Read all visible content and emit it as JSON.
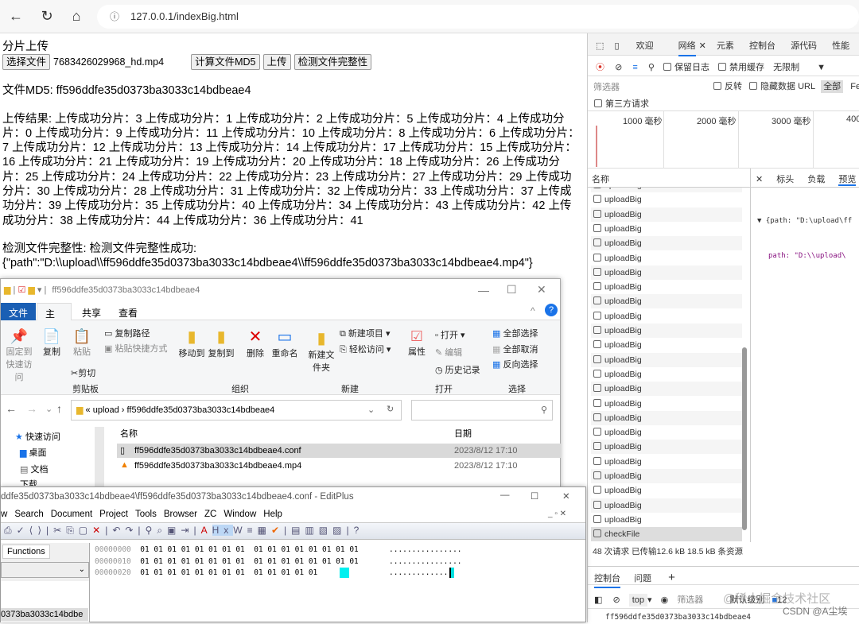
{
  "browser": {
    "url": "127.0.0.1/indexBig.html"
  },
  "page": {
    "title": "分片上传",
    "choose_file": "选择文件",
    "file_name": "7683426029968_hd.mp4",
    "calc_md5": "计算文件MD5",
    "upload": "上传",
    "check": "检测文件完整性",
    "md5_line": "文件MD5: ff596ddfe35d0373ba3033c14bdbeae4",
    "upload_result": "上传结果: 上传成功分片：3 上传成功分片：1 上传成功分片：2 上传成功分片：5 上传成功分片：4 上传成功分片：0 上传成功分片：9 上传成功分片：11 上传成功分片：10 上传成功分片：8 上传成功分片：6 上传成功分片：7 上传成功分片：12 上传成功分片：13 上传成功分片：14 上传成功分片：17 上传成功分片：15 上传成功分片：16 上传成功分片：21 上传成功分片：19 上传成功分片：20 上传成功分片：18 上传成功分片：26 上传成功分片：25 上传成功分片：24 上传成功分片：22 上传成功分片：23 上传成功分片：27 上传成功分片：29 上传成功分片：30 上传成功分片：28 上传成功分片：31 上传成功分片：32 上传成功分片：33 上传成功分片：37 上传成功分片：39 上传成功分片：35 上传成功分片：40 上传成功分片：34 上传成功分片：43 上传成功分片：42 上传成功分片：38 上传成功分片：44 上传成功分片：36 上传成功分片：41",
    "check_result": "检测文件完整性: 检测文件完整性成功:",
    "check_json": "{\"path\":\"D:\\\\upload\\\\ff596ddfe35d0373ba3033c14bdbeae4\\\\ff596ddfe35d0373ba3033c14bdbeae4.mp4\"}"
  },
  "devtools": {
    "tabs": [
      "欢迎",
      "网络",
      "元素",
      "控制台",
      "源代码",
      "性能"
    ],
    "preserve_log": "保留日志",
    "disable_cache": "禁用缓存",
    "throttle": "无限制",
    "filter_placeholder": "筛选器",
    "invert": "反转",
    "hide_data_url": "隐藏数据 URL",
    "all": "全部",
    "fetch": "Fetc",
    "third_party": "第三方请求",
    "timeline": [
      "1000 毫秒",
      "2000 毫秒",
      "3000 毫秒",
      "400"
    ],
    "name_col": "名称",
    "detail_tabs": [
      "标头",
      "负载",
      "预览"
    ],
    "preview_line1": "▼ {path: \"D:\\upload\\ff",
    "preview_line2": "path: \"D:\\\\upload\\",
    "requests": [
      "uploadBig",
      "uploadBig",
      "uploadBig",
      "uploadBig",
      "uploadBig",
      "uploadBig",
      "uploadBig",
      "uploadBig",
      "uploadBig",
      "uploadBig",
      "uploadBig",
      "uploadBig",
      "uploadBig",
      "uploadBig",
      "uploadBig",
      "uploadBig",
      "uploadBig",
      "uploadBig",
      "uploadBig",
      "uploadBig",
      "uploadBig",
      "uploadBig",
      "uploadBig",
      "uploadBig",
      "checkFile"
    ],
    "summary": "48 次请求  已传输12.6 kB  18.5 kB 条资源",
    "console_tab": "控制台",
    "issues_tab": "问题",
    "context": "top",
    "console_filter": "筛选器",
    "levels": "默认级别",
    "issues_count": "12",
    "console_output": "ff596ddfe35d0373ba3033c14bdbeae4",
    "watermark": "@稀土掘金技术社区",
    "csdn": "CSDN @A尘埃"
  },
  "explorer": {
    "title": "ff596ddfe35d0373ba3033c14bdbeae4",
    "tabs": [
      "文件",
      "主页",
      "共享",
      "查看"
    ],
    "ribbon": {
      "pin": "固定到快速访问",
      "copy": "复制",
      "paste": "粘贴",
      "copy_path": "复制路径",
      "paste_shortcut": "粘贴快捷方式",
      "cut": "剪切",
      "clipboard": "剪贴板",
      "move_to": "移动到",
      "copy_to": "复制到",
      "delete": "删除",
      "rename": "重命名",
      "organize": "组织",
      "new_folder": "新建文件夹",
      "new_item": "新建项目",
      "easy_access": "轻松访问",
      "new": "新建",
      "properties": "属性",
      "open": "打开",
      "edit": "编辑",
      "history": "历史记录",
      "open_group": "打开",
      "select_all": "全部选择",
      "select_none": "全部取消",
      "invert_sel": "反向选择",
      "select": "选择"
    },
    "path": [
      "upload",
      "ff596ddfe35d0373ba3033c14bdbeae4"
    ],
    "col_name": "名称",
    "col_date": "日期",
    "sidebar": [
      "快速访问",
      "桌面",
      "文档",
      "下载"
    ],
    "files": [
      {
        "name": "ff596ddfe35d0373ba3033c14bdbeae4.conf",
        "date": "2023/8/12 17:10"
      },
      {
        "name": "ff596ddfe35d0373ba3033c14bdbeae4.mp4",
        "date": "2023/8/12 17:10"
      }
    ]
  },
  "editplus": {
    "title": "ddfe35d0373ba3033c14bdbeae4\\ff596ddfe35d0373ba3033c14bdbeae4.conf - EditPlus",
    "menu": [
      "w",
      "Search",
      "Document",
      "Project",
      "Tools",
      "Browser",
      "ZC",
      "Window",
      "Help"
    ],
    "functions": "Functions",
    "file_tab": "0373ba3033c14bdbe",
    "hex": [
      {
        "off": "00000000",
        "bytes": "01 01 01 01 01 01 01 01  01 01 01 01 01 01 01 01",
        "ascii": "................"
      },
      {
        "off": "00000010",
        "bytes": "01 01 01 01 01 01 01 01  01 01 01 01 01 01 01 01",
        "ascii": "................"
      },
      {
        "off": "00000020",
        "bytes": "01 01 01 01 01 01 01 01  01 01 01 01 01",
        "ascii": "............."
      }
    ]
  }
}
